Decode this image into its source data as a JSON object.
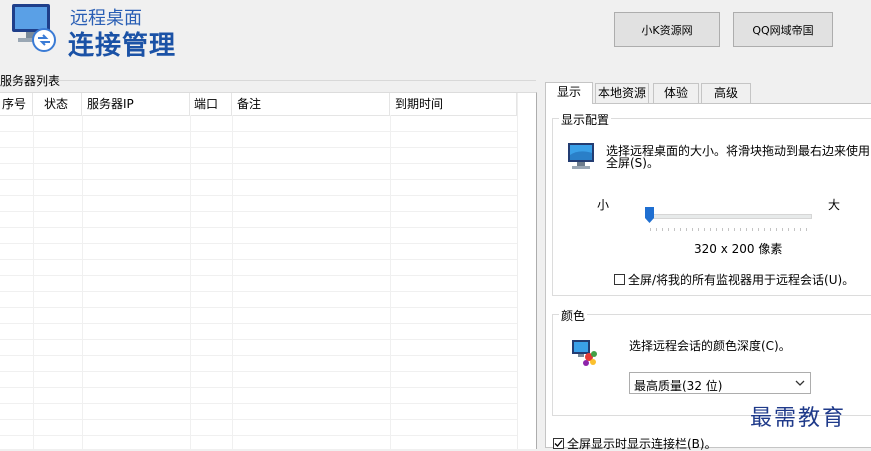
{
  "header": {
    "title_top": "远程桌面",
    "title_main": "连接管理",
    "buttons": [
      {
        "label": "小K资源网"
      },
      {
        "label": "QQ网域帝国"
      }
    ]
  },
  "server_list": {
    "caption": "服务器列表",
    "columns": [
      "序号",
      "状态",
      "服务器IP",
      "端口",
      "备注",
      "到期时间"
    ],
    "rows": []
  },
  "tabs": [
    {
      "label": "显示",
      "active": true
    },
    {
      "label": "本地资源",
      "active": false
    },
    {
      "label": "体验",
      "active": false
    },
    {
      "label": "高级",
      "active": false
    }
  ],
  "display_group": {
    "label": "显示配置",
    "description_line1": "选择远程桌面的大小。将滑块拖动到最右边来使用",
    "description_line2": "全屏(S)。",
    "slider_min_label": "小",
    "slider_max_label": "大",
    "slider_value_fraction": 0,
    "resolution_text": "320 x 200 像素",
    "monitors_checkbox_label": "全屏/将我的所有监视器用于远程会话(U)。",
    "monitors_checked": false,
    "icon": "monitor-icon"
  },
  "color_group": {
    "label": "颜色",
    "description": "选择远程会话的颜色深度(C)。",
    "selected_depth": "最高质量(32 位)",
    "icon": "color-palette-icon"
  },
  "connection_bar_checkbox": {
    "label": "全屏显示时显示连接栏(B)。",
    "checked": true
  },
  "watermark": "最需教育",
  "colors": {
    "title_blue": "#1b52a6",
    "slider_thumb": "#1f6fd1",
    "watermark": "#1f3a8a"
  }
}
